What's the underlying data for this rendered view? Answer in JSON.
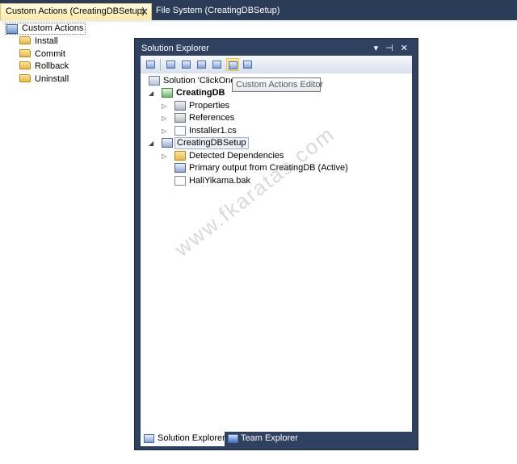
{
  "doc_tabs": {
    "active_label": "Custom Actions (CreatingDBSetup)",
    "inactive_label": "File System (CreatingDBSetup)"
  },
  "custom_actions": {
    "root": "Custom Actions",
    "items": [
      "Install",
      "Commit",
      "Rollback",
      "Uninstall"
    ]
  },
  "solution_explorer": {
    "title": "Solution Explorer",
    "title_buttons": "▾ ⊣ ✕",
    "tooltip": "Custom Actions Editor",
    "tree": {
      "solution": "Solution 'ClickOnc",
      "project": "CreatingDB",
      "properties": "Properties",
      "references": "References",
      "installer": "Installer1.cs",
      "setup": "CreatingDBSetup",
      "detected": "Detected Dependencies",
      "primary_output": "Primary output from CreatingDB (Active)",
      "bak": "HaliYikama.bak"
    },
    "bottom_tabs": {
      "solution": "Solution Explorer",
      "team": "Team Explorer"
    }
  },
  "watermark": "www.fkaratas.com",
  "icons": {
    "close": "close-icon",
    "folder": "folder-icon"
  }
}
